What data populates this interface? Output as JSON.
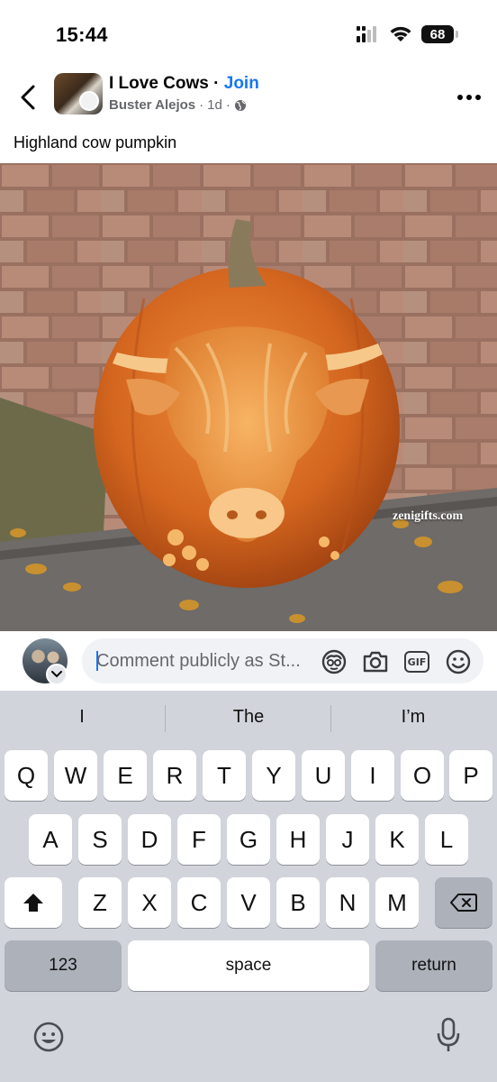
{
  "status_bar": {
    "time": "15:44",
    "battery": "68",
    "icons": [
      "signal-icon",
      "wifi-icon",
      "battery-icon"
    ]
  },
  "post": {
    "group_name": "I Love Cows",
    "separator": " · ",
    "join_label": "Join",
    "author": "Buster Alejos",
    "age": "1d",
    "privacy_icon": "globe-icon",
    "caption": "Highland cow pumpkin",
    "watermark": "zenigifts.com"
  },
  "comment_bar": {
    "placeholder": "Comment publicly as St...",
    "icons": [
      "avatar-sticker-icon",
      "camera-icon",
      "gif-icon",
      "emoji-icon"
    ],
    "gif_label": "GIF"
  },
  "keyboard": {
    "suggestions": [
      "I",
      "The",
      "I’m"
    ],
    "row1": [
      "Q",
      "W",
      "E",
      "R",
      "T",
      "Y",
      "U",
      "I",
      "O",
      "P"
    ],
    "row2": [
      "A",
      "S",
      "D",
      "F",
      "G",
      "H",
      "J",
      "K",
      "L"
    ],
    "row3": [
      "Z",
      "X",
      "C",
      "V",
      "B",
      "N",
      "M"
    ],
    "numbers_label": "123",
    "space_label": "space",
    "return_label": "return",
    "bottom_icons": [
      "emoji-keyboard-icon",
      "microphone-icon"
    ]
  },
  "colors": {
    "accent": "#1877f2",
    "secondary_text": "#65676b",
    "keyboard_bg": "#d1d4db",
    "key_dark": "#acb1ba"
  }
}
